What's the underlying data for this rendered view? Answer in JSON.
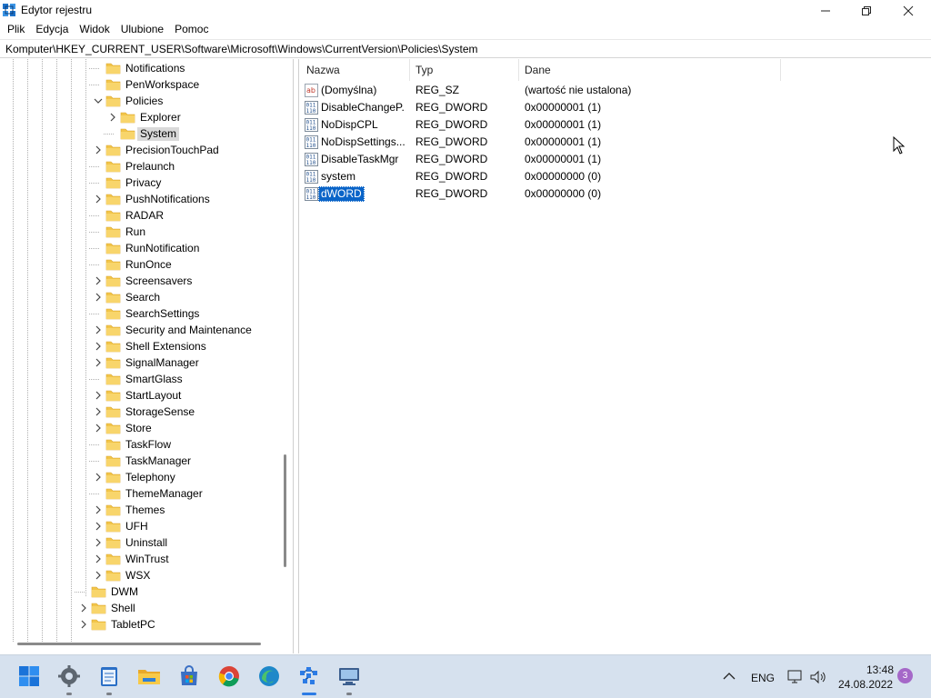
{
  "window": {
    "title": "Edytor rejestru"
  },
  "menu": [
    "Plik",
    "Edycja",
    "Widok",
    "Ulubione",
    "Pomoc"
  ],
  "address": "Komputer\\HKEY_CURRENT_USER\\Software\\Microsoft\\Windows\\CurrentVersion\\Policies\\System",
  "tree": [
    {
      "label": "Notifications",
      "expander": "none",
      "level": 3
    },
    {
      "label": "PenWorkspace",
      "expander": "none",
      "level": 3
    },
    {
      "label": "Policies",
      "expander": "expanded",
      "level": 3
    },
    {
      "label": "Explorer",
      "expander": "collapsed",
      "level": 4
    },
    {
      "label": "System",
      "expander": "none",
      "level": 4,
      "selected": true
    },
    {
      "label": "PrecisionTouchPad",
      "expander": "collapsed",
      "level": 3
    },
    {
      "label": "Prelaunch",
      "expander": "none",
      "level": 3
    },
    {
      "label": "Privacy",
      "expander": "none",
      "level": 3
    },
    {
      "label": "PushNotifications",
      "expander": "collapsed",
      "level": 3
    },
    {
      "label": "RADAR",
      "expander": "none",
      "level": 3
    },
    {
      "label": "Run",
      "expander": "none",
      "level": 3
    },
    {
      "label": "RunNotification",
      "expander": "none",
      "level": 3
    },
    {
      "label": "RunOnce",
      "expander": "none",
      "level": 3
    },
    {
      "label": "Screensavers",
      "expander": "collapsed",
      "level": 3
    },
    {
      "label": "Search",
      "expander": "collapsed",
      "level": 3
    },
    {
      "label": "SearchSettings",
      "expander": "none",
      "level": 3
    },
    {
      "label": "Security and Maintenance",
      "expander": "collapsed",
      "level": 3
    },
    {
      "label": "Shell Extensions",
      "expander": "collapsed",
      "level": 3
    },
    {
      "label": "SignalManager",
      "expander": "collapsed",
      "level": 3
    },
    {
      "label": "SmartGlass",
      "expander": "none",
      "level": 3
    },
    {
      "label": "StartLayout",
      "expander": "collapsed",
      "level": 3
    },
    {
      "label": "StorageSense",
      "expander": "collapsed",
      "level": 3
    },
    {
      "label": "Store",
      "expander": "collapsed",
      "level": 3
    },
    {
      "label": "TaskFlow",
      "expander": "none",
      "level": 3
    },
    {
      "label": "TaskManager",
      "expander": "none",
      "level": 3
    },
    {
      "label": "Telephony",
      "expander": "collapsed",
      "level": 3
    },
    {
      "label": "ThemeManager",
      "expander": "none",
      "level": 3
    },
    {
      "label": "Themes",
      "expander": "collapsed",
      "level": 3
    },
    {
      "label": "UFH",
      "expander": "collapsed",
      "level": 3
    },
    {
      "label": "Uninstall",
      "expander": "collapsed",
      "level": 3
    },
    {
      "label": "WinTrust",
      "expander": "collapsed",
      "level": 3
    },
    {
      "label": "WSX",
      "expander": "collapsed",
      "level": 3
    },
    {
      "label": "DWM",
      "expander": "none",
      "level": 2
    },
    {
      "label": "Shell",
      "expander": "collapsed",
      "level": 2
    },
    {
      "label": "TabletPC",
      "expander": "collapsed",
      "level": 2
    }
  ],
  "columns": {
    "name": "Nazwa",
    "type": "Typ",
    "data": "Dane"
  },
  "values": [
    {
      "name": "(Domyślna)",
      "type": "REG_SZ",
      "data": "(wartość nie ustalona)",
      "icon": "string-value-icon"
    },
    {
      "name": "DisableChangeP...",
      "type": "REG_DWORD",
      "data": "0x00000001 (1)",
      "icon": "binary-value-icon"
    },
    {
      "name": "NoDispCPL",
      "type": "REG_DWORD",
      "data": "0x00000001 (1)",
      "icon": "binary-value-icon"
    },
    {
      "name": "NoDispSettings...",
      "type": "REG_DWORD",
      "data": "0x00000001 (1)",
      "icon": "binary-value-icon"
    },
    {
      "name": "DisableTaskMgr",
      "type": "REG_DWORD",
      "data": "0x00000001 (1)",
      "icon": "binary-value-icon"
    },
    {
      "name": "system",
      "type": "REG_DWORD",
      "data": "0x00000000 (0)",
      "icon": "binary-value-icon"
    },
    {
      "name": "dWORD",
      "type": "REG_DWORD",
      "data": "0x00000000 (0)",
      "icon": "binary-value-icon",
      "selected": true
    }
  ],
  "taskbar": {
    "apps": [
      "start-icon",
      "settings-icon",
      "notepad-icon",
      "file-explorer-icon",
      "store-icon",
      "chrome-icon",
      "edge-icon",
      "regedit-icon",
      "remote-desktop-icon"
    ],
    "language": "ENG",
    "time": "13:48",
    "date": "24.08.2022",
    "notifications": "3"
  },
  "colors": {
    "selection": "#0a64c8",
    "folder": "#f2c54a",
    "taskbar": "#d6e1ee",
    "badge": "#a568c8"
  }
}
